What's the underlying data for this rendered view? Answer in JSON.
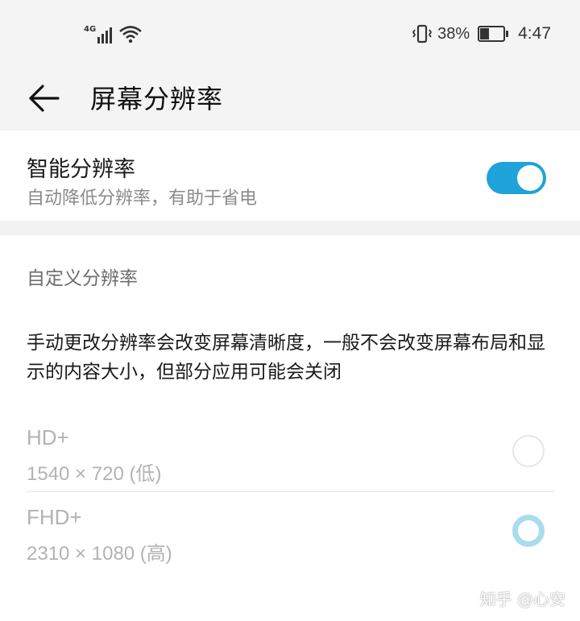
{
  "status_bar": {
    "network_type": "4G",
    "battery_percent": "38%",
    "battery_level": 0.38,
    "time": "4:47",
    "icons": [
      "signal-icon",
      "wifi-icon",
      "vibrate-icon",
      "battery-icon"
    ]
  },
  "header": {
    "title": "屏幕分辨率",
    "back_icon": "arrow-left-icon"
  },
  "smart_resolution": {
    "title": "智能分辨率",
    "subtitle": "自动降低分辨率，有助于省电",
    "enabled": true
  },
  "custom_resolution": {
    "section_title": "自定义分辨率",
    "description": "手动更改分辨率会改变屏幕清晰度，一般不会改变屏幕布局和显示的内容大小，但部分应用可能会关闭",
    "options": [
      {
        "name": "HD+",
        "detail": "1540 × 720 (低)",
        "selected": false
      },
      {
        "name": "FHD+",
        "detail": "2310 × 1080 (高)",
        "selected": true
      }
    ]
  },
  "watermark": "知乎 @心安",
  "colors": {
    "accent": "#1fa3d8",
    "radio_selected": "#a9dcee",
    "disabled_text": "#b3b3b3",
    "header_bg": "#f4f4f4"
  }
}
